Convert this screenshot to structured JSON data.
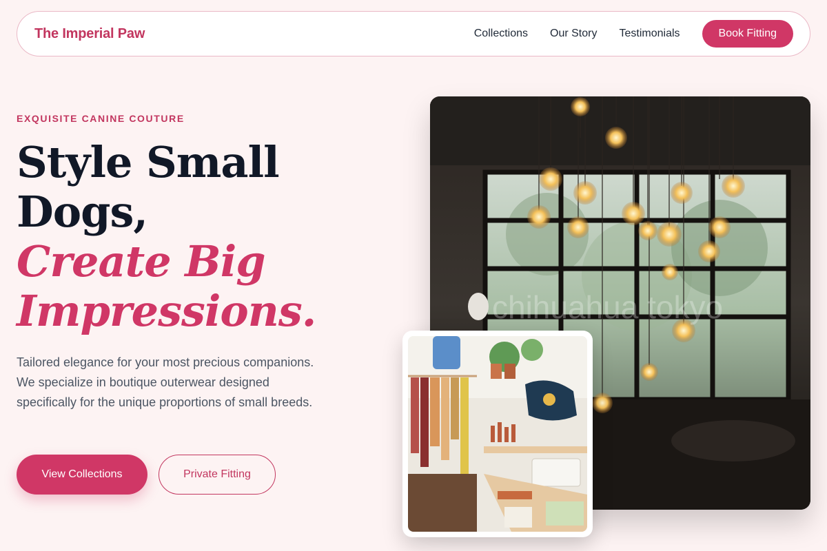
{
  "nav": {
    "brand": "The Imperial Paw",
    "links": [
      "Collections",
      "Our Story",
      "Testimonials"
    ],
    "cta": "Book Fitting"
  },
  "hero": {
    "eyebrow": "EXQUISITE CANINE COUTURE",
    "headline_line1": "Style Small",
    "headline_line2": "Dogs,",
    "headline_accent1": "Create Big",
    "headline_accent2": "Impressions.",
    "description": "Tailored elegance for your most precious companions. We specialize in boutique outerwear designed specifically for the unique proportions of small breeds.",
    "primary_button": "View Collections",
    "secondary_button": "Private Fitting",
    "watermark": "chihuahua tokyo"
  },
  "colors": {
    "accent": "#d03766",
    "background": "#fdf3f3",
    "heading": "#111827"
  }
}
